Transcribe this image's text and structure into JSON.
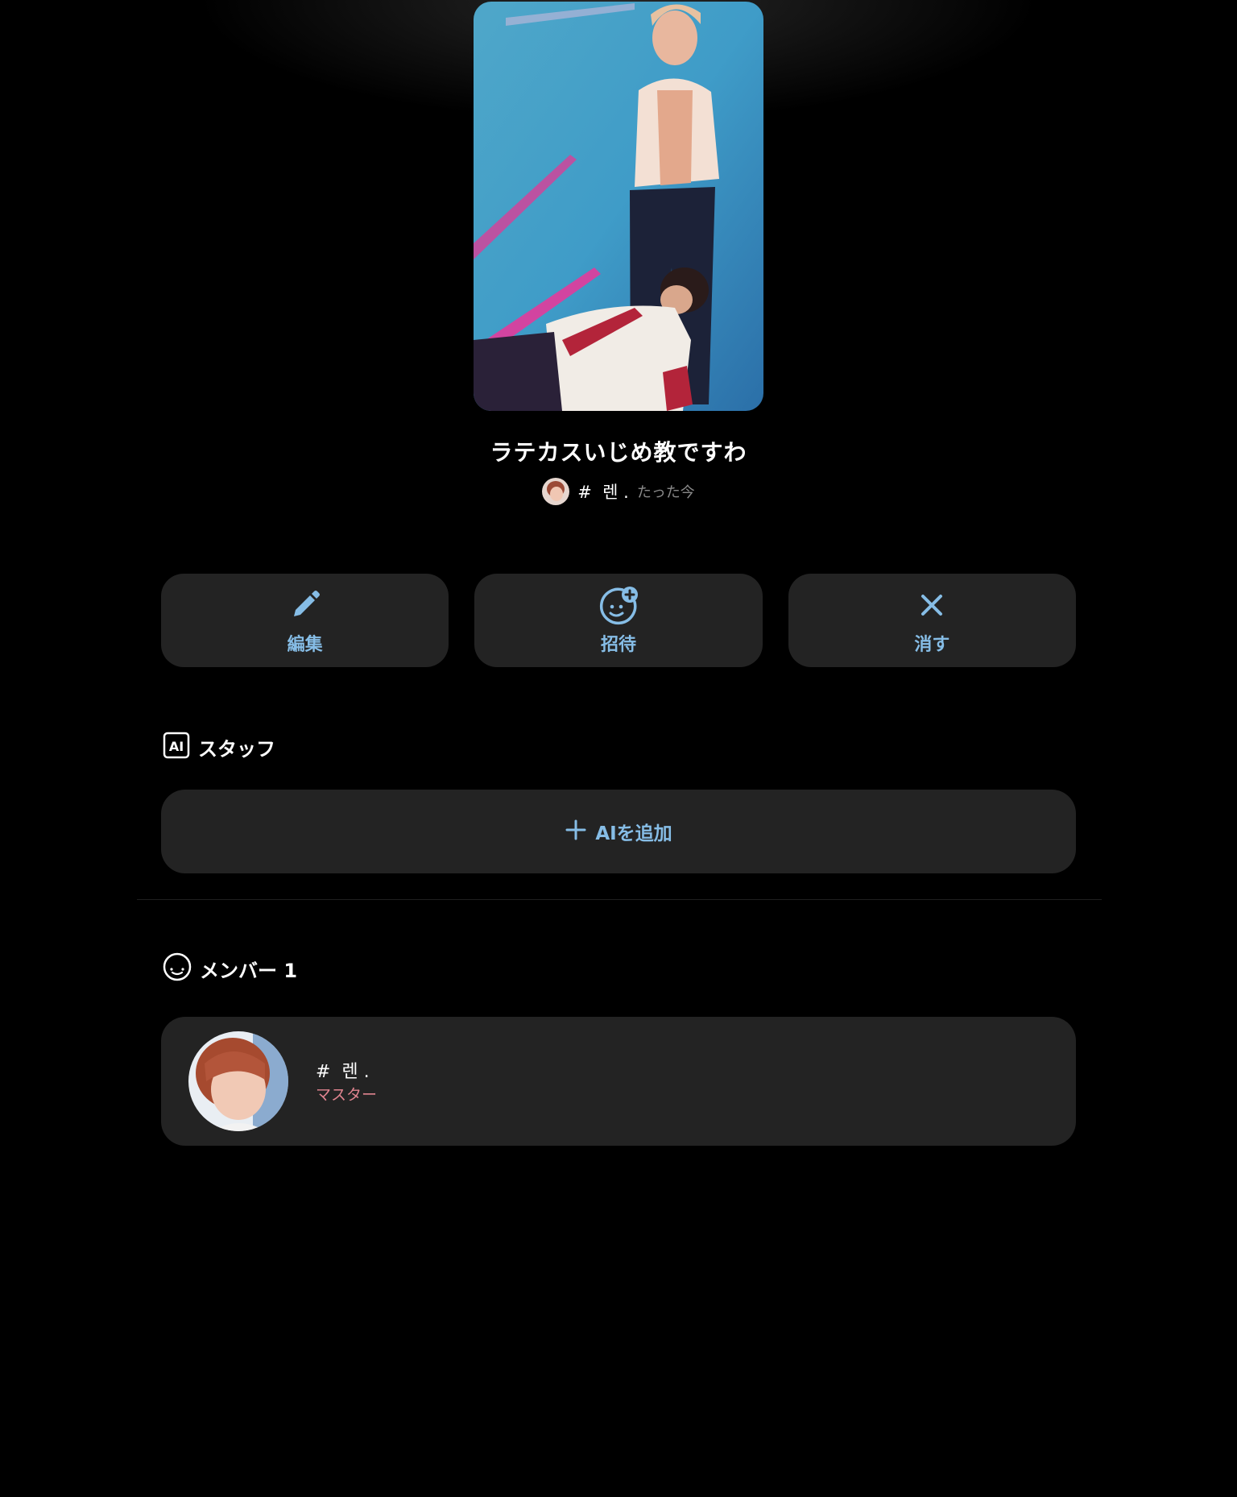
{
  "room": {
    "title": "ラテカスいじめ教ですわ",
    "owner_name": "#  렌 .",
    "time": "たった今"
  },
  "actions": [
    {
      "label": "編集",
      "icon": "pencil-icon"
    },
    {
      "label": "招待",
      "icon": "invite-person-plus-icon"
    },
    {
      "label": "消す",
      "icon": "close-icon"
    }
  ],
  "staff_section": {
    "title": "スタッフ",
    "icon": "ai-badge-icon",
    "badge_text": "AI",
    "add_label": "AIを追加"
  },
  "member_section": {
    "title": "メンバー 1",
    "icon": "smile-face-icon",
    "members": [
      {
        "name": "#  렌 .",
        "role": "マスター"
      }
    ]
  },
  "colors": {
    "background": "#000000",
    "card": "#232323",
    "accent": "#86bde6",
    "role": "#e0848f"
  }
}
